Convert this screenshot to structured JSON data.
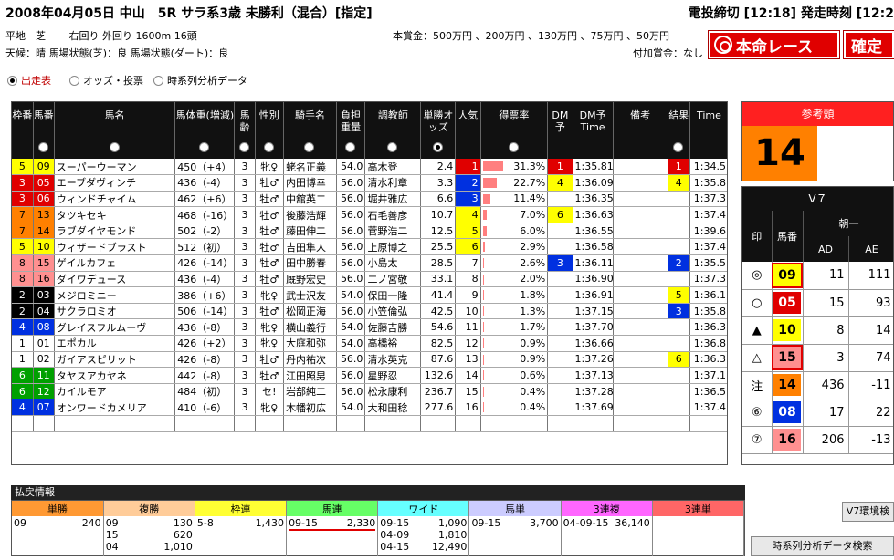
{
  "header": {
    "title": "2008年04月05日 中山　5R サラ系3歳 未勝利（混合）[指定]",
    "deadline": "電投締切 [12:18] 発走時刻 [12:2",
    "course": "平地　芝　　 右回り 外回り 1600m 16頭",
    "condition": "天候：晴 馬場状態(芝)：良 馬場状態(ダート)：良",
    "prize": "本賞金：500万円 、200万円 、130万円 、75万円 、50万円",
    "added_prize": "付加賞金：なし",
    "honmei_label": "本命レース",
    "kakutei_label": "確定"
  },
  "tabs": [
    {
      "label": "出走表",
      "selected": true
    },
    {
      "label": "オッズ・投票",
      "selected": false
    },
    {
      "label": "時系列分析データ",
      "selected": false
    }
  ],
  "columns": {
    "waku": "枠番",
    "uma": "馬番",
    "name": "馬名",
    "weight": "馬体重(増減)",
    "age": "馬齢",
    "sex": "性別",
    "jockey": "騎手名",
    "burden": "負担重量",
    "trainer": "調教師",
    "odds": "単勝オッズ",
    "pop": "人気",
    "vote_rate": "得票率",
    "dm": "DM予",
    "dm_time": "DM予Time",
    "note": "備考",
    "result": "結果",
    "time": "Time"
  },
  "horses": [
    {
      "waku": "5",
      "uma": "09",
      "name": "スーパーウーマン",
      "weight": "450（+4）",
      "age": "3",
      "sex": "牝♀",
      "jockey": "蛯名正義",
      "burden": "54.0",
      "trainer": "高木登",
      "odds": "2.4",
      "pop": "1",
      "rate": 31.3,
      "rate_text": "31.3%",
      "dm": "1",
      "dm_time": "1:35.81",
      "result": "1",
      "time": "1:34.5"
    },
    {
      "waku": "3",
      "uma": "05",
      "name": "エーブダヴィンチ",
      "weight": "436（-4）",
      "age": "3",
      "sex": "牡♂",
      "jockey": "内田博幸",
      "burden": "56.0",
      "trainer": "清水利章",
      "odds": "3.3",
      "pop": "2",
      "rate": 22.7,
      "rate_text": "22.7%",
      "dm": "4",
      "dm_time": "1:36.09",
      "result": "4",
      "time": "1:35.8"
    },
    {
      "waku": "3",
      "uma": "06",
      "name": "ウィンドチャイム",
      "weight": "462（+6）",
      "age": "3",
      "sex": "牡♂",
      "jockey": "中舘英二",
      "burden": "56.0",
      "trainer": "堀井雅広",
      "odds": "6.6",
      "pop": "3",
      "rate": 11.4,
      "rate_text": "11.4%",
      "dm": "",
      "dm_time": "1:36.35",
      "result": "",
      "time": "1:37.3"
    },
    {
      "waku": "7",
      "uma": "13",
      "name": "タツキセキ",
      "weight": "468（-16）",
      "age": "3",
      "sex": "牡♂",
      "jockey": "後藤浩輝",
      "burden": "56.0",
      "trainer": "石毛善彦",
      "odds": "10.7",
      "pop": "4",
      "rate": 7.0,
      "rate_text": "7.0%",
      "dm": "6",
      "dm_time": "1:36.63",
      "result": "",
      "time": "1:37.4"
    },
    {
      "waku": "7",
      "uma": "14",
      "name": "ラブダイヤモンド",
      "weight": "502（-2）",
      "age": "3",
      "sex": "牡♂",
      "jockey": "藤田伸二",
      "burden": "56.0",
      "trainer": "菅野浩二",
      "odds": "12.5",
      "pop": "5",
      "rate": 6.0,
      "rate_text": "6.0%",
      "dm": "",
      "dm_time": "1:36.55",
      "result": "",
      "time": "1:39.6"
    },
    {
      "waku": "5",
      "uma": "10",
      "name": "ウィザードブラスト",
      "weight": "512（初）",
      "age": "3",
      "sex": "牡♂",
      "jockey": "吉田隼人",
      "burden": "56.0",
      "trainer": "上原博之",
      "odds": "25.5",
      "pop": "6",
      "rate": 2.9,
      "rate_text": "2.9%",
      "dm": "",
      "dm_time": "1:36.58",
      "result": "",
      "time": "1:37.4"
    },
    {
      "waku": "8",
      "uma": "15",
      "name": "ゲイルカフェ",
      "weight": "426（-14）",
      "age": "3",
      "sex": "牡♂",
      "jockey": "田中勝春",
      "burden": "56.0",
      "trainer": "小島太",
      "odds": "28.5",
      "pop": "7",
      "rate": 2.6,
      "rate_text": "2.6%",
      "dm": "3",
      "dm_time": "1:36.11",
      "result": "2",
      "time": "1:35.5"
    },
    {
      "waku": "8",
      "uma": "16",
      "name": "ダイワデュース",
      "weight": "436（-4）",
      "age": "3",
      "sex": "牡♂",
      "jockey": "厩野宏史",
      "burden": "56.0",
      "trainer": "二ノ宮敬",
      "odds": "33.1",
      "pop": "8",
      "rate": 2.0,
      "rate_text": "2.0%",
      "dm": "",
      "dm_time": "1:36.90",
      "result": "",
      "time": "1:37.3"
    },
    {
      "waku": "2",
      "uma": "03",
      "name": "メジロミニー",
      "weight": "386（+6）",
      "age": "3",
      "sex": "牝♀",
      "jockey": "武士沢友",
      "burden": "54.0",
      "trainer": "保田一隆",
      "odds": "41.4",
      "pop": "9",
      "rate": 1.8,
      "rate_text": "1.8%",
      "dm": "",
      "dm_time": "1:36.91",
      "result": "5",
      "time": "1:36.1"
    },
    {
      "waku": "2",
      "uma": "04",
      "name": "サクラロミオ",
      "weight": "506（-14）",
      "age": "3",
      "sex": "牡♂",
      "jockey": "松岡正海",
      "burden": "56.0",
      "trainer": "小笠倫弘",
      "odds": "42.5",
      "pop": "10",
      "rate": 1.3,
      "rate_text": "1.3%",
      "dm": "",
      "dm_time": "1:37.15",
      "result": "3",
      "time": "1:35.8"
    },
    {
      "waku": "4",
      "uma": "08",
      "name": "グレイスフルムーヴ",
      "weight": "436（-8）",
      "age": "3",
      "sex": "牝♀",
      "jockey": "横山義行",
      "burden": "54.0",
      "trainer": "佐藤吉勝",
      "odds": "54.6",
      "pop": "11",
      "rate": 1.7,
      "rate_text": "1.7%",
      "dm": "",
      "dm_time": "1:37.70",
      "result": "",
      "time": "1:36.3"
    },
    {
      "waku": "1",
      "uma": "01",
      "name": "エポカル",
      "weight": "426（+2）",
      "age": "3",
      "sex": "牝♀",
      "jockey": "大庭和弥",
      "burden": "54.0",
      "trainer": "高橋裕",
      "odds": "82.5",
      "pop": "12",
      "rate": 0.9,
      "rate_text": "0.9%",
      "dm": "",
      "dm_time": "1:36.66",
      "result": "",
      "time": "1:36.8"
    },
    {
      "waku": "1",
      "uma": "02",
      "name": "ガイアスピリット",
      "weight": "426（-8）",
      "age": "3",
      "sex": "牡♂",
      "jockey": "丹内祐次",
      "burden": "56.0",
      "trainer": "清水英克",
      "odds": "87.6",
      "pop": "13",
      "rate": 0.9,
      "rate_text": "0.9%",
      "dm": "",
      "dm_time": "1:37.26",
      "result": "6",
      "time": "1:36.3"
    },
    {
      "waku": "6",
      "uma": "11",
      "name": "タヤスアカヤネ",
      "weight": "442（-8）",
      "age": "3",
      "sex": "牡♂",
      "jockey": "江田照男",
      "burden": "56.0",
      "trainer": "星野忍",
      "odds": "132.6",
      "pop": "14",
      "rate": 0.6,
      "rate_text": "0.6%",
      "dm": "",
      "dm_time": "1:37.13",
      "result": "",
      "time": "1:37.1"
    },
    {
      "waku": "6",
      "uma": "12",
      "name": "カイルモア",
      "weight": "484（初）",
      "age": "3",
      "sex": "セ!",
      "jockey": "岩部純二",
      "burden": "56.0",
      "trainer": "松永康利",
      "odds": "236.7",
      "pop": "15",
      "rate": 0.4,
      "rate_text": "0.4%",
      "dm": "",
      "dm_time": "1:37.28",
      "result": "",
      "time": "1:36.5"
    },
    {
      "waku": "4",
      "uma": "07",
      "name": "オンワードカメリア",
      "weight": "410（-6）",
      "age": "3",
      "sex": "牝♀",
      "jockey": "木幡初広",
      "burden": "54.0",
      "trainer": "大和田稔",
      "odds": "277.6",
      "pop": "16",
      "rate": 0.4,
      "rate_text": "0.4%",
      "dm": "",
      "dm_time": "1:37.69",
      "result": "",
      "time": "1:37.4"
    }
  ],
  "payout": {
    "title": "払戻情報",
    "cols": [
      {
        "label": "単勝",
        "bg": "#ff9933",
        "lines": [
          [
            "09",
            "240"
          ]
        ]
      },
      {
        "label": "複勝",
        "bg": "#ffcc99",
        "lines": [
          [
            "09",
            "130"
          ],
          [
            "15",
            "620"
          ],
          [
            "04",
            "1,010"
          ]
        ]
      },
      {
        "label": "枠連",
        "bg": "#ffff33",
        "lines": [
          [
            "5-8",
            "1,430"
          ]
        ]
      },
      {
        "label": "馬連",
        "bg": "#66ff66",
        "lines": [
          [
            "09-15",
            "2,330"
          ]
        ]
      },
      {
        "label": "ワイド",
        "bg": "#66ffff",
        "lines": [
          [
            "09-15",
            "1,090"
          ],
          [
            "04-09",
            "1,810"
          ],
          [
            "04-15",
            "12,490"
          ]
        ]
      },
      {
        "label": "馬単",
        "bg": "#ccccff",
        "lines": [
          [
            "09-15",
            "3,700"
          ]
        ]
      },
      {
        "label": "3連複",
        "bg": "#ff66ff",
        "lines": [
          [
            "04-09-15",
            "36,140"
          ]
        ]
      },
      {
        "label": "3連単",
        "bg": "#ff6666",
        "lines": []
      }
    ]
  },
  "reference": {
    "title": "参考頭",
    "number": "14"
  },
  "v7": {
    "title": "V７",
    "sub": "朝一",
    "cols": {
      "mark": "印",
      "uma": "馬番",
      "ad": "AD",
      "ae": "AE"
    },
    "rows": [
      {
        "mark": "◎",
        "uma": "09",
        "ad": "11",
        "ae": "111",
        "waku": "5",
        "hl": true
      },
      {
        "mark": "○",
        "uma": "05",
        "ad": "15",
        "ae": "93",
        "waku": "3",
        "hl": false
      },
      {
        "mark": "▲",
        "uma": "10",
        "ad": "8",
        "ae": "14",
        "waku": "5",
        "hl": false
      },
      {
        "mark": "△",
        "uma": "15",
        "ad": "3",
        "ae": "74",
        "waku": "8",
        "hl": true
      },
      {
        "mark": "注",
        "uma": "14",
        "ad": "436",
        "ae": "-11",
        "waku": "7",
        "hl": false
      },
      {
        "mark": "⑥",
        "uma": "08",
        "ad": "17",
        "ae": "22",
        "waku": "4",
        "hl": false
      },
      {
        "mark": "⑦",
        "uma": "16",
        "ad": "206",
        "ae": "-13",
        "waku": "8",
        "hl": false
      }
    ]
  },
  "buttons": {
    "v7_search": "V7環境検",
    "ts_search": "時系列分析データ検索"
  }
}
